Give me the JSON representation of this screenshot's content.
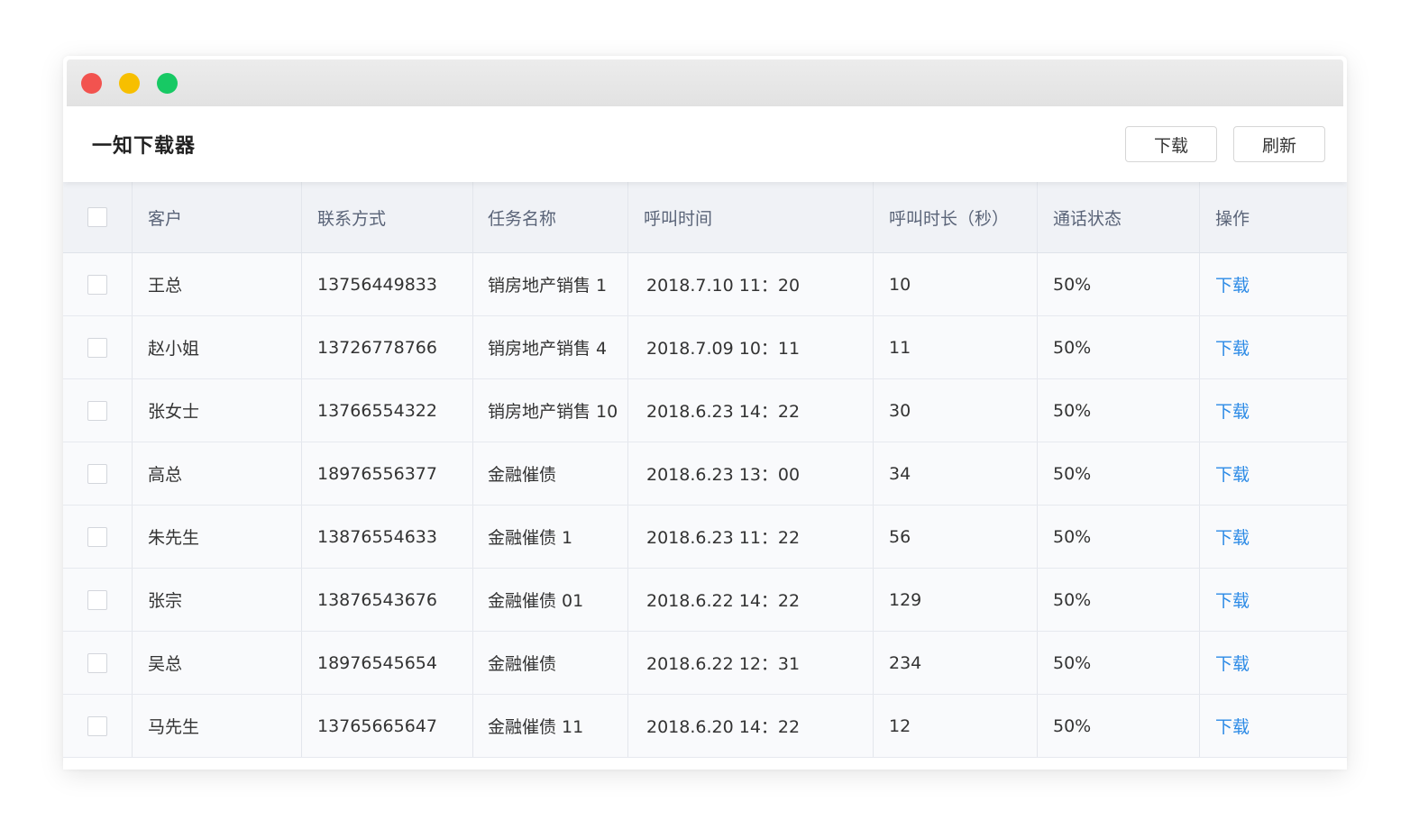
{
  "window": {
    "title": "一知下载器",
    "buttons": {
      "download_label": "下载",
      "refresh_label": "刷新"
    }
  },
  "table": {
    "columns": [
      "客户",
      "联系方式",
      "任务名称",
      "呼叫时间",
      "呼叫时长（秒）",
      "通话状态",
      "操作"
    ],
    "rows": [
      {
        "customer": "王总",
        "phone": "13756449833",
        "task": "销房地产销售 1",
        "time": "2018.7.10   11：20",
        "duration": "10",
        "status": "50%",
        "action": "下载"
      },
      {
        "customer": "赵小姐",
        "phone": "13726778766",
        "task": "销房地产销售 4",
        "time": "2018.7.09  10：11",
        "duration": "11",
        "status": "50%",
        "action": "下载"
      },
      {
        "customer": "张女士",
        "phone": "13766554322",
        "task": "销房地产销售 10",
        "time": "2018.6.23   14：22",
        "duration": "30",
        "status": "50%",
        "action": "下载"
      },
      {
        "customer": "高总",
        "phone": "18976556377",
        "task": "金融催债",
        "time": "2018.6.23   13：00",
        "duration": "34",
        "status": "50%",
        "action": "下载"
      },
      {
        "customer": "朱先生",
        "phone": "13876554633",
        "task": "金融催债 1",
        "time": "2018.6.23   11：22",
        "duration": "56",
        "status": "50%",
        "action": "下载"
      },
      {
        "customer": "张宗",
        "phone": "13876543676",
        "task": "金融催债 01",
        "time": "2018.6.22   14：22",
        "duration": "129",
        "status": "50%",
        "action": "下载"
      },
      {
        "customer": "吴总",
        "phone": "18976545654",
        "task": "金融催债",
        "time": "2018.6.22  12：31",
        "duration": "234",
        "status": "50%",
        "action": "下载"
      },
      {
        "customer": "马先生",
        "phone": "13765665647",
        "task": "金融催债 11",
        "time": "2018.6.20   14：22",
        "duration": "12",
        "status": "50%",
        "action": "下载"
      }
    ]
  },
  "colors": {
    "link": "#2b8ae6",
    "close": "#f2534f",
    "minimize": "#f7bf00",
    "maximize": "#17c964"
  }
}
